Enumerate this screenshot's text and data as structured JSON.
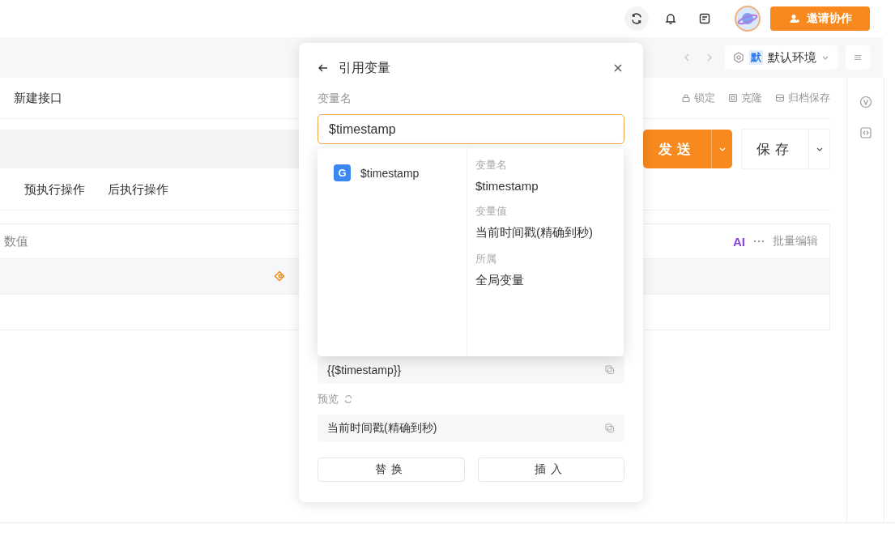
{
  "top_bar": {
    "invite_button": "邀请协作"
  },
  "env_bar": {
    "env_badge": "默",
    "env_name": "默认环境"
  },
  "request": {
    "name": "新建接口",
    "actions": [
      {
        "kind": "lock",
        "label": "锁定"
      },
      {
        "kind": "clone",
        "label": "克隆"
      },
      {
        "kind": "archive",
        "label": "归档保存"
      }
    ],
    "send_button": "发送",
    "save_button": "保存"
  },
  "tabs": [
    {
      "label": "预执行操作"
    },
    {
      "label": "后执行操作"
    }
  ],
  "table": {
    "columns": [
      "数值"
    ],
    "ai_label": "AI",
    "batch_edit": "批量编辑"
  },
  "popup": {
    "title": "引用变量",
    "field_label": "变量名",
    "field_value": "$timestamp",
    "suggestions": [
      {
        "badge": "G",
        "name": "$timestamp"
      }
    ],
    "details": [
      {
        "label": "变量名",
        "value": "$timestamp"
      },
      {
        "label": "变量值",
        "value": "当前时间戳(精确到秒)"
      },
      {
        "label": "所属",
        "value": "全局变量"
      }
    ],
    "expression": "{{$timestamp}}",
    "preview_label": "预览",
    "preview_value": "当前时间戳(精确到秒)",
    "buttons": [
      "替换",
      "插入"
    ]
  }
}
